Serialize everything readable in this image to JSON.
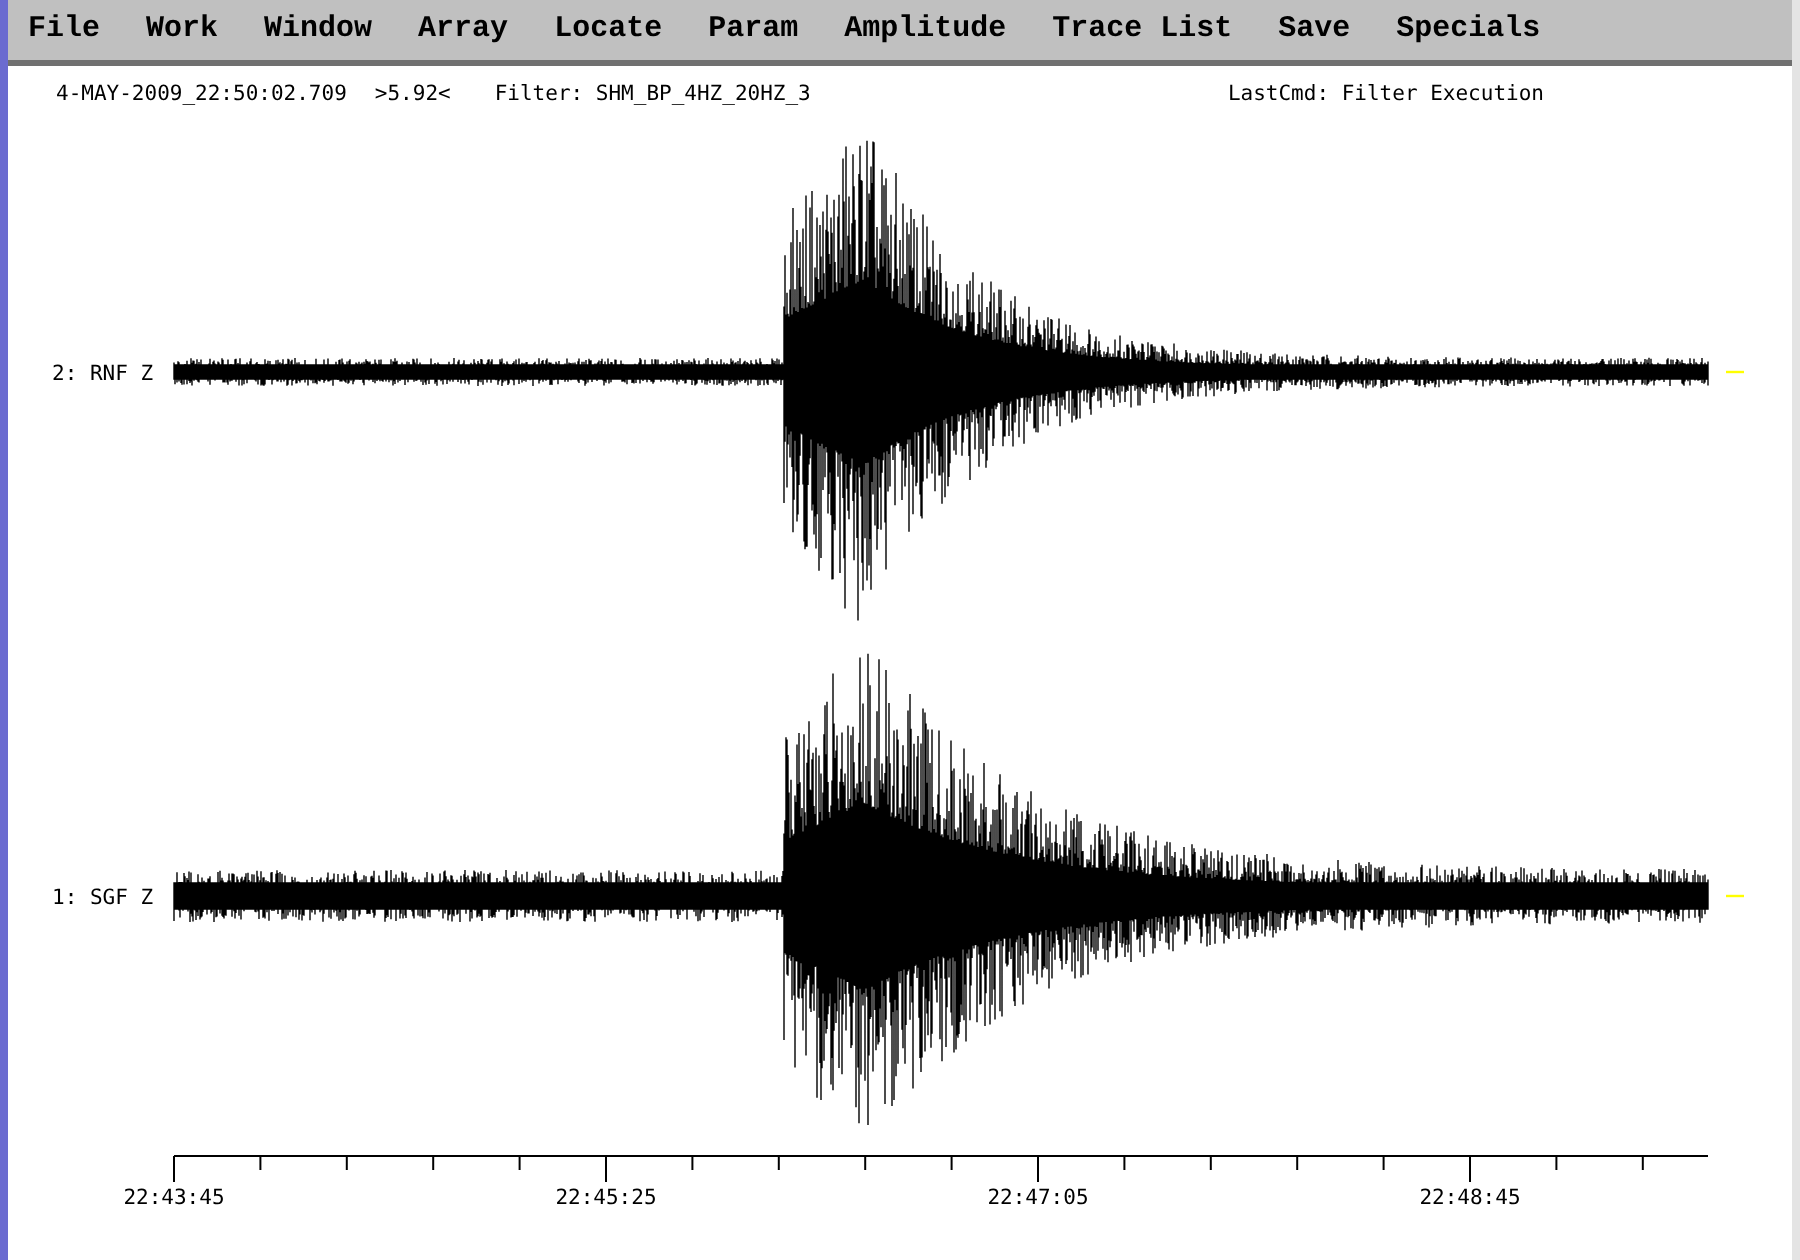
{
  "menu": [
    "File",
    "Work",
    "Window",
    "Array",
    "Locate",
    "Param",
    "Amplitude",
    "Trace List",
    "Save",
    "Specials"
  ],
  "header": {
    "time": "4-MAY-2009_22:50:02.709",
    "zoom": ">5.92<",
    "filter": "Filter: SHM_BP_4HZ_20HZ_3",
    "last_cmd": "LastCmd: Filter Execution"
  },
  "traces": [
    {
      "label": "2: RNF Z"
    },
    {
      "label": "1: SGF Z"
    }
  ],
  "time_axis": {
    "labels": [
      "22:43:45",
      "22:45:25",
      "22:47:05",
      "22:48:45"
    ]
  }
}
